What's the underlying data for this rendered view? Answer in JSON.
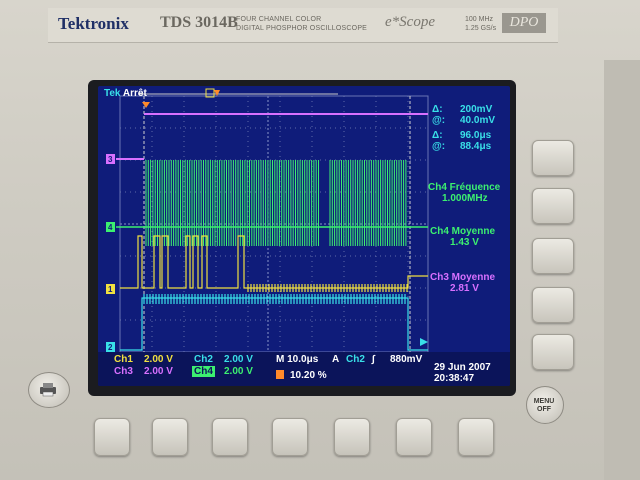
{
  "header": {
    "brand": "Tektronix",
    "model": "TDS 3014B",
    "model_sub_line1": "FOUR CHANNEL COLOR",
    "model_sub_line2": "DIGITAL PHOSPHOR OSCILLOSCOPE",
    "escope": "e*Scope",
    "spec_line1": "100 MHz",
    "spec_line2": "1.25 GS/s",
    "series": "DPO"
  },
  "screen": {
    "status": {
      "brand_prefix": "Tek",
      "state": "Arrêt"
    },
    "cursors": {
      "v_delta": "200mV",
      "v_at": "40.0mV",
      "t_delta": "96.0μs",
      "t_at": "88.4μs",
      "delta_symbol": "Δ:",
      "at_symbol": "@:"
    },
    "measurements": [
      {
        "label": "Ch4 Fréquence",
        "value": "1.000MHz",
        "color": "#3cf070"
      },
      {
        "label": "Ch4 Moyenne",
        "value": "1.43 V",
        "color": "#3cf070"
      },
      {
        "label": "Ch3 Moyenne",
        "value": "2.81 V",
        "color": "#d870ff"
      }
    ],
    "channel_markers": [
      "3",
      "4",
      "1",
      "2"
    ],
    "bottom": {
      "ch1_label": "Ch1",
      "ch1_value": "2.00 V",
      "ch2_label": "Ch2",
      "ch2_value": "2.00 V",
      "ch3_label": "Ch3",
      "ch3_value": "2.00 V",
      "ch4_label": "Ch4",
      "ch4_value": "2.00 V",
      "timebase": "M 10.0μs",
      "trigger_mode": "A",
      "trigger_source": "Ch2",
      "trigger_slope": "∫",
      "trigger_level": "880mV",
      "position": "10.20 %",
      "date": "29 Jun  2007",
      "time": "20:38:47"
    }
  },
  "controls": {
    "menu_off": "MENU OFF"
  },
  "colors": {
    "screen_bg": "#0f1c7a",
    "ch1": "#f0e040",
    "ch2": "#39e0e8",
    "ch3": "#d870ff",
    "ch4": "#3cf070"
  }
}
